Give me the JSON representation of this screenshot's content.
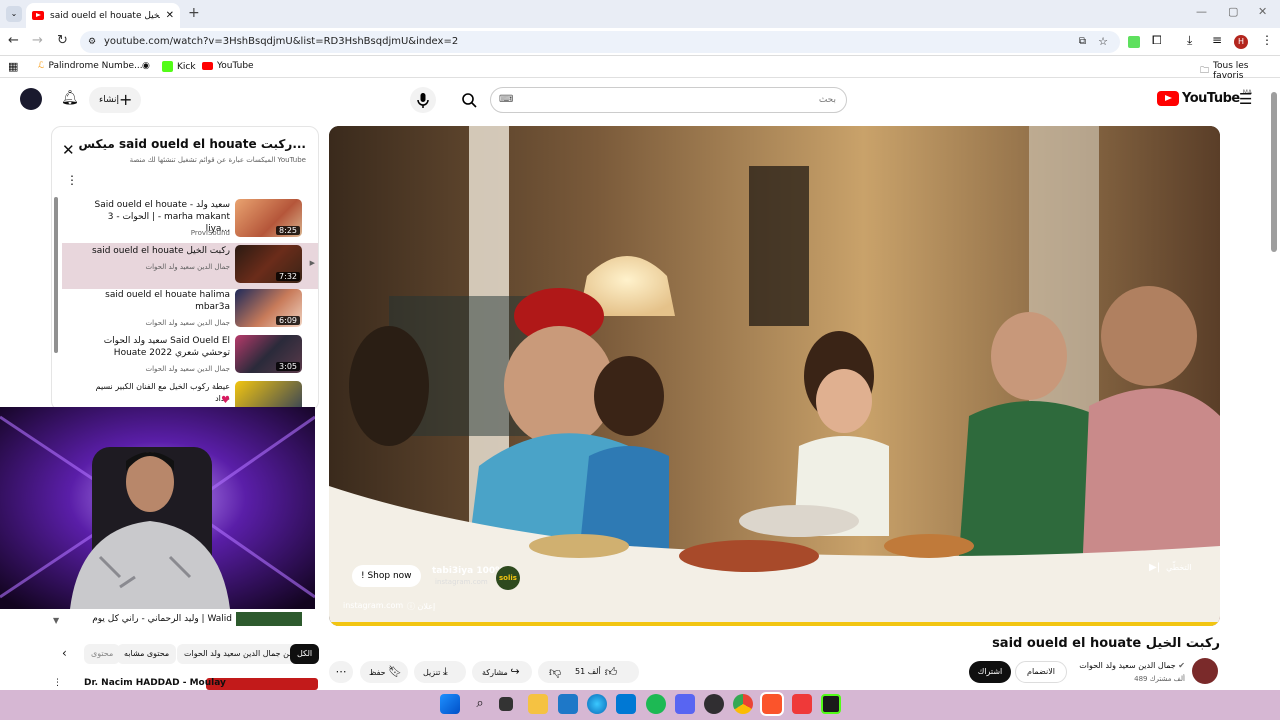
{
  "browser": {
    "tab_title": "said oueld el houate ركبت الخيل",
    "url": "youtube.com/watch?v=3HshBsqdjmU&list=RD3HshBsqdjmU&index=2",
    "bookmarks": [
      "Palindrome Numbe...",
      "Kick",
      "YouTube"
    ],
    "all_bookmarks": "Tous les favoris",
    "profile_initial": "H"
  },
  "youtube": {
    "logo_text": "YouTube",
    "logo_region": "MA",
    "search_placeholder": "بحث",
    "create_label": "إنشاء"
  },
  "playlist": {
    "title": "ميكس said oueld el houate ركبت...",
    "subtitle": "الميكسات عبارة عن قوائم تشغيل تنشئها لك منصة YouTube",
    "items": [
      {
        "title": "Said oueld el houate - سعيد ولد الحوات - 3 | - marha makant liya...",
        "channel": "ProviSound",
        "duration": "8:25"
      },
      {
        "title": "said oueld el houate ركبت الخيل",
        "channel": "جمال الدين سعيد ولد الحوات",
        "duration": "7:32"
      },
      {
        "title": "said oueld el houate halima mbar3a",
        "channel": "جمال الدين سعيد ولد الحوات",
        "duration": "6:09"
      },
      {
        "title": "سعيد ولد الحوات Said Oueld El Houate توحشي شعري 2022",
        "channel": "جمال الدين سعيد ولد الحوات",
        "duration": "3:05"
      },
      {
        "title": "عيطة ركوب الخيل مع الفنان الكبير نسيم حداد",
        "channel": "",
        "duration": ""
      }
    ]
  },
  "ad": {
    "shop_button": "! Shop now",
    "advertiser": "tabi3iya 100%",
    "domain": "instagram.com",
    "brand": "solis",
    "footer_domain": "instagram.com",
    "ad_label": "إعلان",
    "skip_label": "التخطّي"
  },
  "video": {
    "title": "said oueld el houate ركبت الخيل",
    "channel_name": "جمال الدين سعيد ولد الحوات",
    "subscribers": "489 ألف مشترك",
    "subscribe_label": "اشتراك",
    "join_label": "الانضمام",
    "like_count": "51 ألف",
    "share_label": "مشاركة",
    "download_label": "تنزيل",
    "save_label": "حفظ"
  },
  "chips": [
    "الكل",
    "من جمال الدين سعيد ولد الحوات",
    "محتوى مشابه",
    "محتوى"
  ],
  "below_playlist": [
    {
      "title": "وليد الرحماني - راني كل يوم | Walid"
    },
    {
      "title": "Dr. Nacim HADDAD - Moulay"
    }
  ]
}
